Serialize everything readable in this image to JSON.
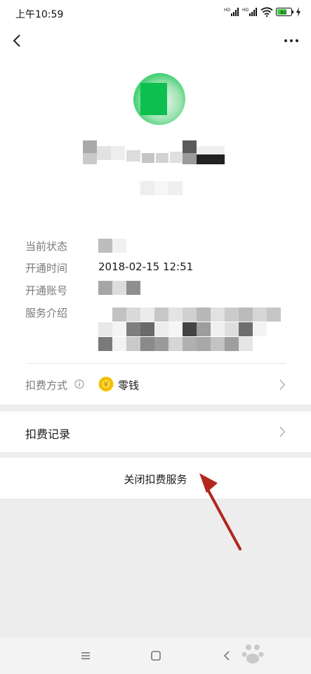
{
  "status_bar": {
    "time": "上午10:59",
    "signal1": "HD",
    "signal2": "HD",
    "battery": "60"
  },
  "icons": {
    "back": "chevron-left-icon",
    "more": "more-dots-icon",
    "info": "info-circle-icon",
    "coin": "coin-icon",
    "chevron": "chevron-right-icon"
  },
  "info": {
    "status_label": "当前状态",
    "open_time_label": "开通时间",
    "open_time_value": "2018-02-15 12:51",
    "account_label": "开通账号",
    "service_intro_label": "服务介绍"
  },
  "payment": {
    "label": "扣费方式",
    "value": "零钱"
  },
  "records": {
    "label": "扣费记录"
  },
  "close": {
    "label": "关闭扣费服务"
  },
  "colors": {
    "accent_green": "#0dbf4f",
    "coin_yellow": "#f2c400",
    "annotation_red": "#b3261e",
    "gap_gray": "#ededed"
  }
}
